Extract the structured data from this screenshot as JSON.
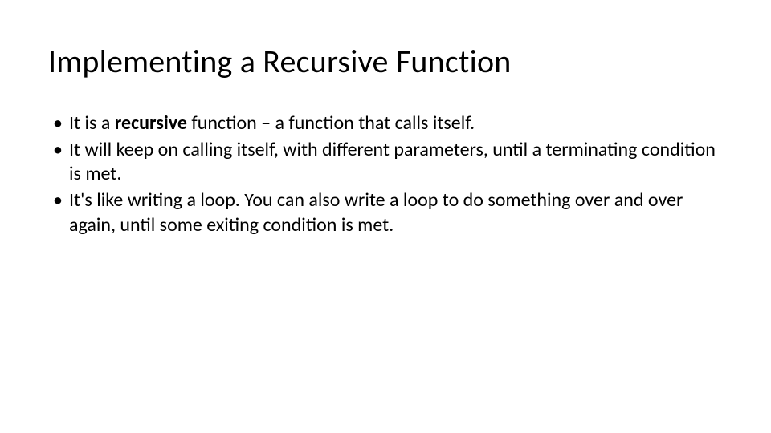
{
  "slide": {
    "title": "Implementing a Recursive Function",
    "bullets": [
      {
        "pre": "It is a ",
        "bold": "recursive",
        "post": " function – a function that calls itself."
      },
      {
        "text": "It will keep on calling itself, with different parameters, until a terminating condition is met."
      },
      {
        "text": "It's like writing a loop. You can also write a loop to do something over and over again, until some exiting condition is met."
      }
    ]
  }
}
